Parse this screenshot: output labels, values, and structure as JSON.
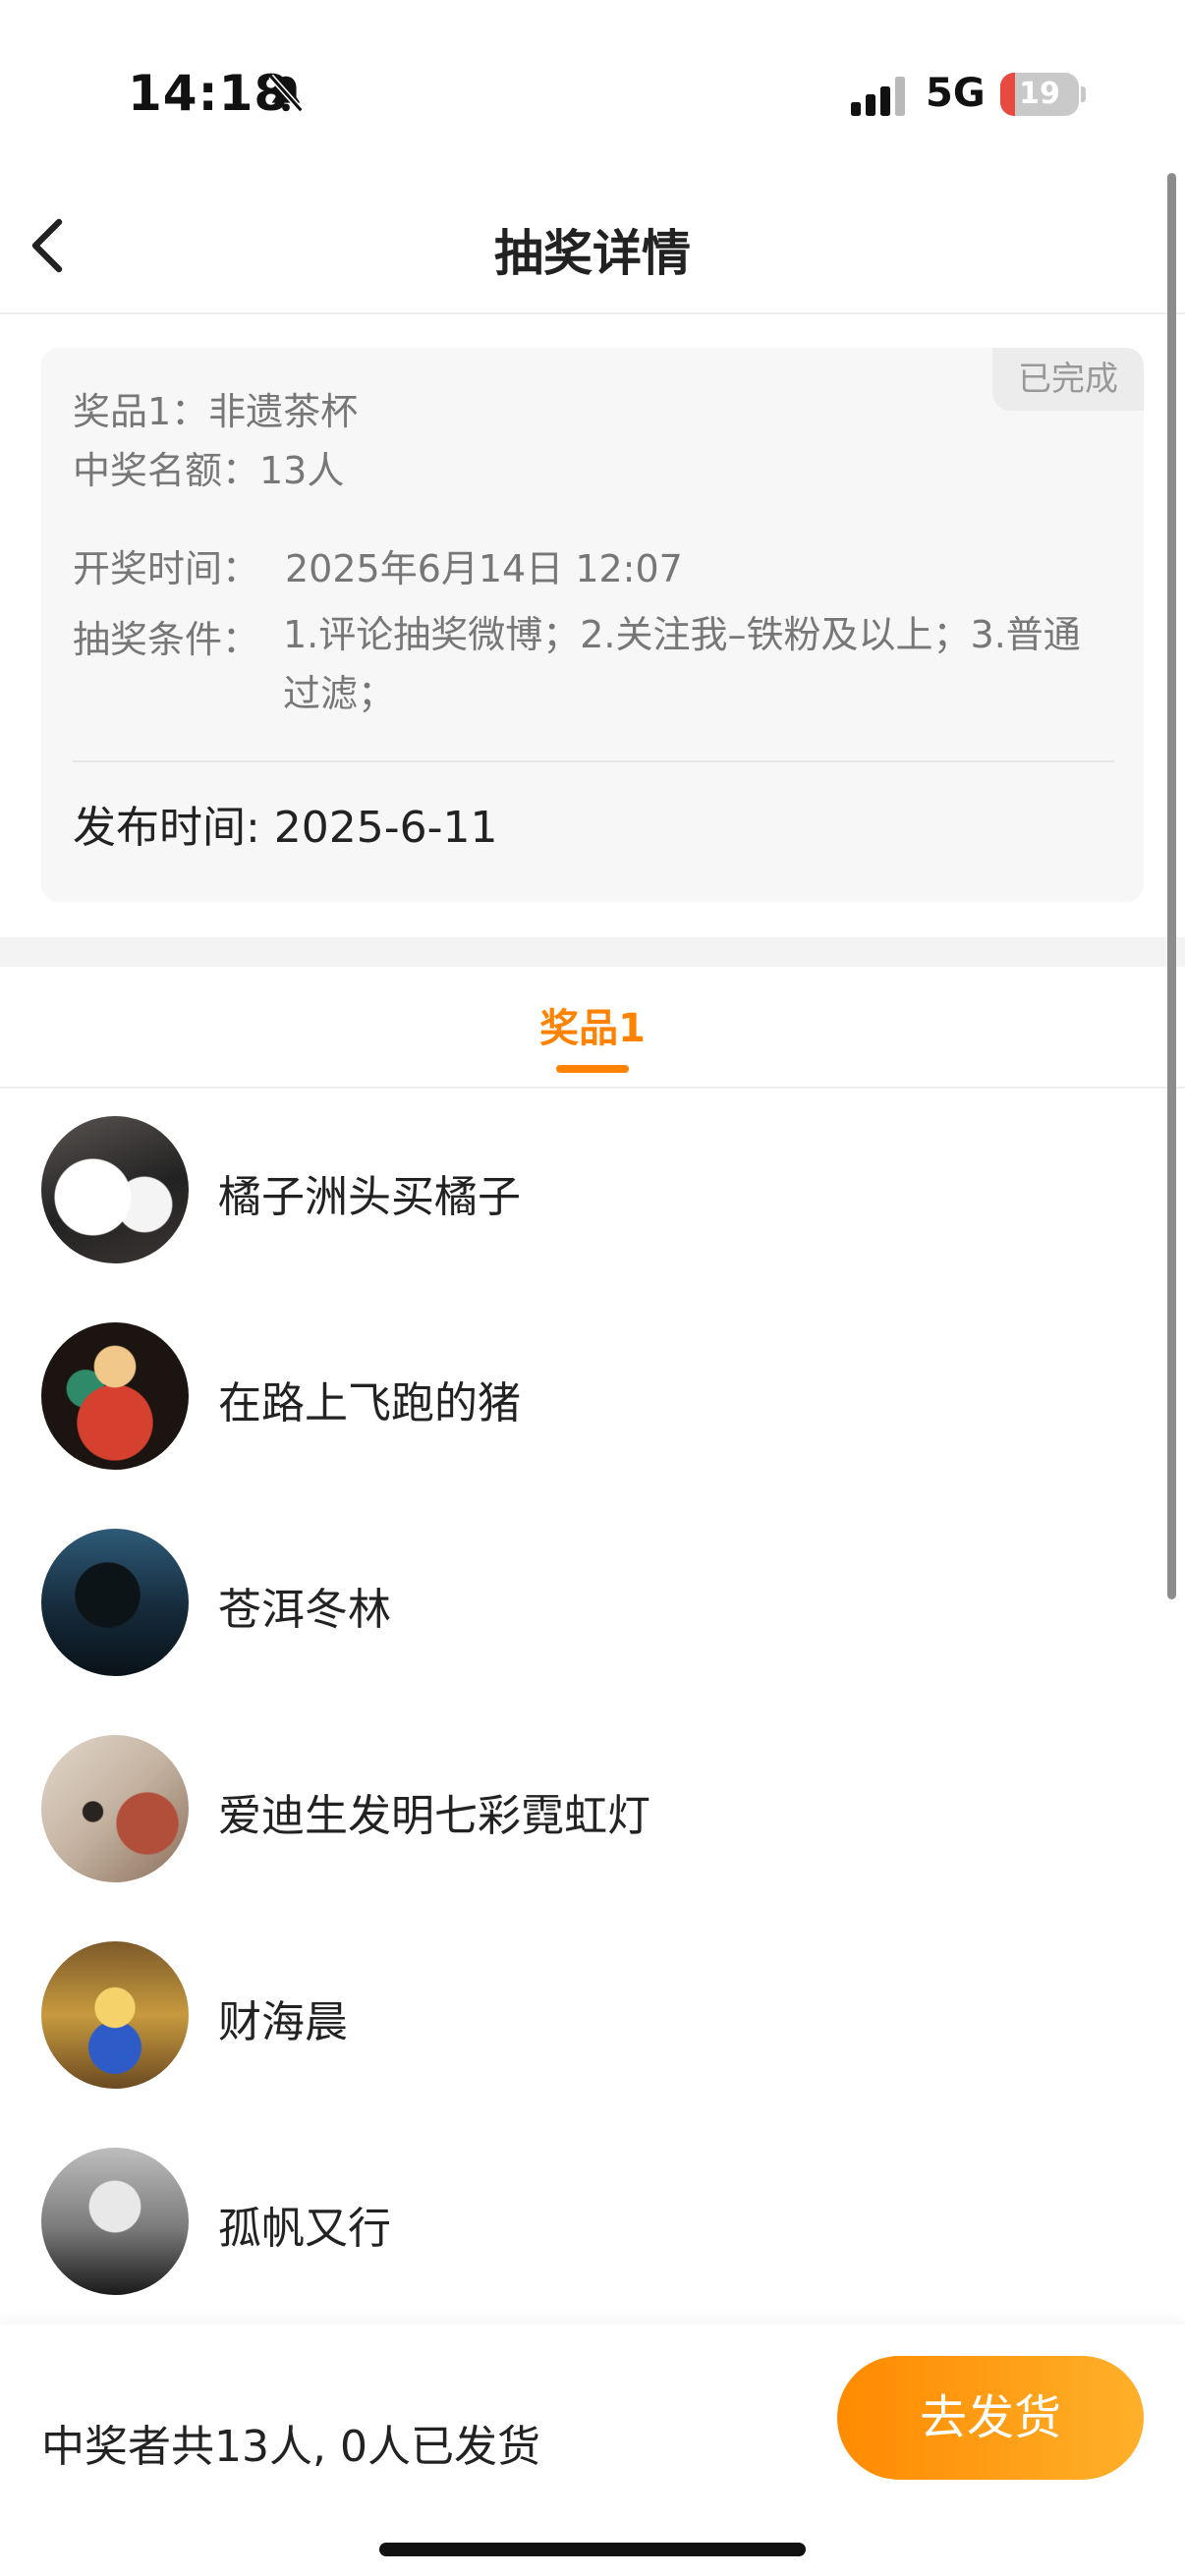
{
  "status_bar": {
    "time": "14:18",
    "network": "5G",
    "battery_level": "19",
    "battery_fraction": 0.19,
    "icons": [
      "bell-slash-icon",
      "signal-bars-icon",
      "battery-icon"
    ]
  },
  "nav": {
    "title": "抽奖详情",
    "back_icon": "chevron-left-icon"
  },
  "lottery": {
    "status": "已完成",
    "prize_line": "奖品1：非遗茶杯",
    "quota_line": "中奖名额：13人",
    "draw_time_label": "开奖时间：",
    "draw_time": "2025年6月14日 12:07",
    "conditions_label": "抽奖条件：",
    "conditions": "1.评论抽奖微博；2.关注我–铁粉及以上；3.普通过滤；",
    "publish_time": "发布时间: 2025-6-11"
  },
  "tabs": [
    {
      "label": "奖品1",
      "active": true
    }
  ],
  "winners": [
    {
      "name": "橘子洲头买橘子"
    },
    {
      "name": "在路上飞跑的猪"
    },
    {
      "name": "苍洱冬林"
    },
    {
      "name": "爱迪生发明七彩霓虹灯"
    },
    {
      "name": "财海晨"
    },
    {
      "name": "孤帆又行"
    }
  ],
  "footer": {
    "summary": "中奖者共13人, 0人已发货",
    "ship_button": "去发货"
  },
  "colors": {
    "accent": "#ff8200",
    "button_gradient_start": "#ff8a00",
    "button_gradient_end": "#ffb02a",
    "battery_low": "#e84a3f"
  }
}
